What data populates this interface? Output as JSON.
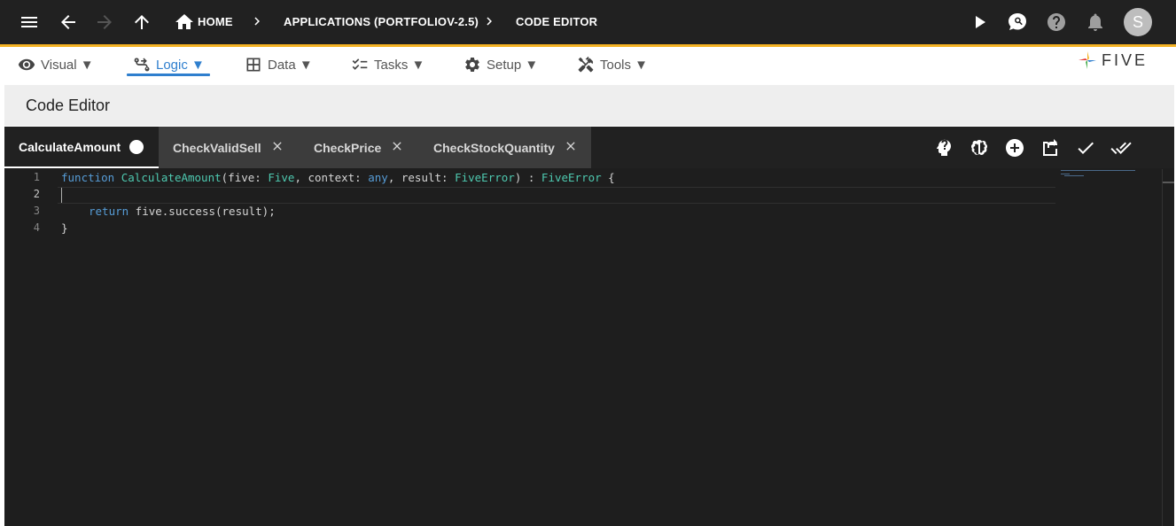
{
  "topbar": {
    "breadcrumbs": [
      "HOME",
      "APPLICATIONS (PORTFOLIOV-2.5)",
      "CODE EDITOR"
    ],
    "user_initial": "S"
  },
  "menu": {
    "items": [
      {
        "label": "Visual ▼",
        "icon": "eye-icon"
      },
      {
        "label": "Logic ▼",
        "icon": "logic-icon",
        "active": true
      },
      {
        "label": "Data ▼",
        "icon": "table-icon"
      },
      {
        "label": "Tasks ▼",
        "icon": "checklist-icon"
      },
      {
        "label": "Setup ▼",
        "icon": "gear-icon"
      },
      {
        "label": "Tools ▼",
        "icon": "tools-icon"
      }
    ],
    "accent_color": "#2f7fce"
  },
  "logo": {
    "text": "FIVE"
  },
  "page": {
    "title": "Code Editor"
  },
  "editor": {
    "tabs": [
      {
        "label": "CalculateAmount",
        "active": true,
        "modified": true
      },
      {
        "label": "CheckValidSell",
        "active": false
      },
      {
        "label": "CheckPrice",
        "active": false
      },
      {
        "label": "CheckStockQuantity",
        "active": false
      }
    ],
    "line_numbers": [
      "1",
      "2",
      "3",
      "4"
    ],
    "code": {
      "line1": {
        "kw_function": "function",
        "fn_name": "CalculateAmount",
        "p1": "(five: ",
        "t1": "Five",
        "p2": ", context: ",
        "t2": "any",
        "p3": ", result: ",
        "t3": "FiveError",
        "p4": ") : ",
        "t4": "FiveError",
        "p5": " {"
      },
      "line3": {
        "kw_return": "return",
        "rest": " five.success(result);"
      },
      "line4": "}"
    },
    "accent_color": "#1e1e1e"
  }
}
